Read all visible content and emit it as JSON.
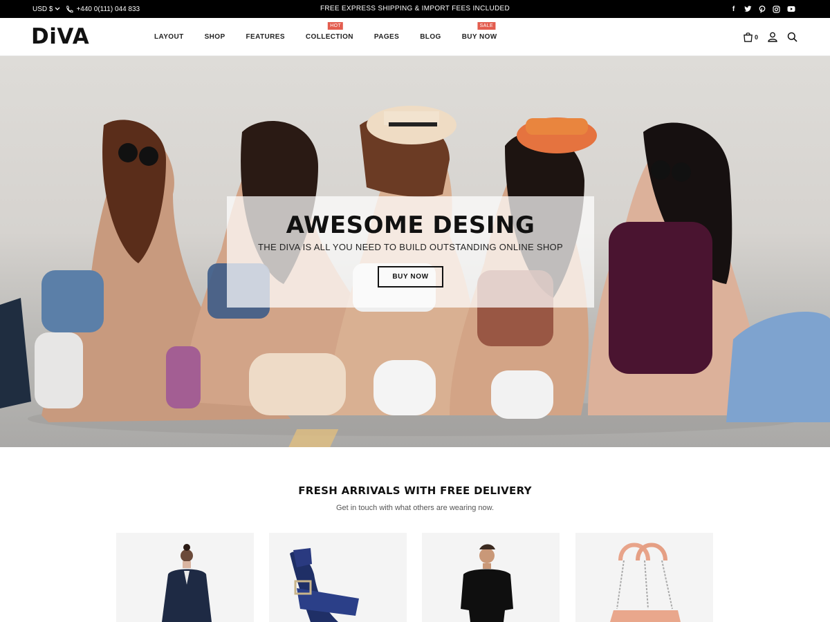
{
  "topbar": {
    "currency": "USD $",
    "phone": "+440 0(111) 044 833",
    "announcement": "FREE EXPRESS SHIPPING & IMPORT FEES INCLUDED",
    "social_icons": [
      "facebook-icon",
      "twitter-icon",
      "pinterest-icon",
      "instagram-icon",
      "youtube-icon"
    ]
  },
  "header": {
    "logo": "DiVA",
    "nav": [
      {
        "label": "LAYOUT",
        "badge": ""
      },
      {
        "label": "SHOP",
        "badge": ""
      },
      {
        "label": "FEATURES",
        "badge": ""
      },
      {
        "label": "COLLECTION",
        "badge": "HOT"
      },
      {
        "label": "PAGES",
        "badge": ""
      },
      {
        "label": "BLOG",
        "badge": ""
      },
      {
        "label": "BUY NOW",
        "badge": "SALE"
      }
    ],
    "cart_count": "0",
    "icons": [
      "cart-icon",
      "user-icon",
      "search-icon"
    ]
  },
  "hero": {
    "title": "AWESOME DESING",
    "subtitle": "THE DIVA IS ALL YOU NEED TO BUILD OUTSTANDING ONLINE SHOP",
    "button": "BUY NOW"
  },
  "arrivals": {
    "title": "FRESH ARRIVALS WITH FREE DELIVERY",
    "subtitle": "Get in touch with what others are wearing now."
  },
  "colors": {
    "accent": "#e35d4f",
    "topbar_bg": "#000000"
  }
}
